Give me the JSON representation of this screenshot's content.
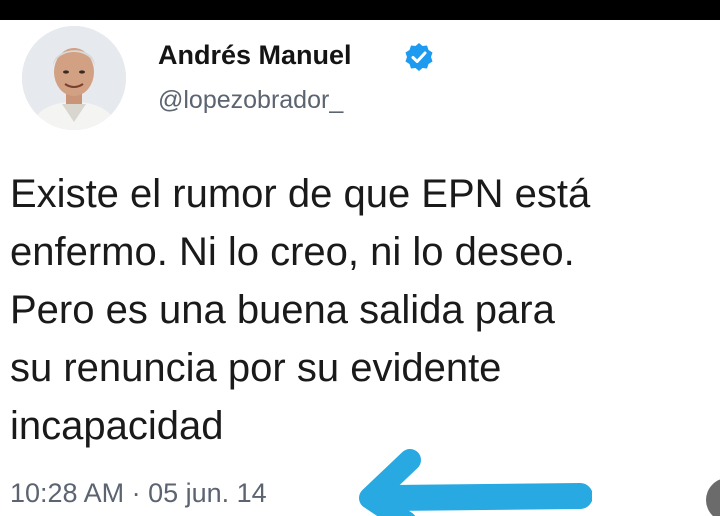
{
  "tweet": {
    "author": {
      "name": "Andrés Manuel",
      "handle": "@lopezobrador_",
      "avatar_icon": "profile-photo",
      "verified_icon": "verified-badge-icon",
      "verified_color": "#1d9bf0"
    },
    "text_lines": [
      "Existe el rumor de que EPN está",
      "enfermo. Ni lo creo, ni lo deseo.",
      "Pero es una buena salida para",
      "su renuncia por su evidente",
      "incapacidad"
    ],
    "timestamp": "10:28 AM · 05 jun. 14"
  },
  "annotation": {
    "arrow_icon": "arrow-left-icon",
    "arrow_color": "#29a9e1"
  }
}
